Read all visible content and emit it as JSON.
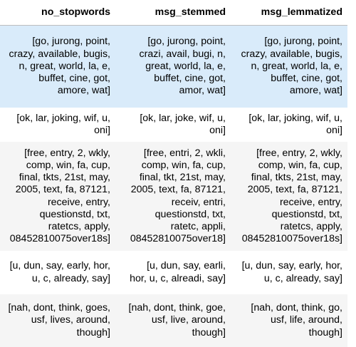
{
  "table": {
    "columns": [
      "no_stopwords",
      "msg_stemmed",
      "msg_lemmatized"
    ],
    "rows": [
      [
        "[go, jurong, point,\ncrazy, available, bugis,\nn, great, world, la, e,\nbuffet, cine, got,\namore, wat]",
        "[go, jurong, point,\ncrazi, avail, bugi, n,\ngreat, world, la, e,\nbuffet, cine, got,\namor, wat]",
        "[go, jurong, point,\ncrazy, available, bugis,\nn, great, world, la, e,\nbuffet, cine, got,\namore, wat]"
      ],
      [
        "[ok, lar, joking, wif, u,\noni]",
        "[ok, lar, joke, wif, u,\noni]",
        "[ok, lar, joking, wif, u,\noni]"
      ],
      [
        "[free, entry, 2, wkly,\ncomp, win, fa, cup,\nfinal, tkts, 21st, may,\n2005, text, fa, 87121,\nreceive, entry,\nquestionstd, txt,\nratetcs, apply,\n08452810075over18s]",
        "[free, entri, 2, wkli,\ncomp, win, fa, cup,\nfinal, tkt, 21st, may,\n2005, text, fa, 87121,\nreceiv, entri,\nquestionstd, txt,\nratetc, appli,\n08452810075over18]",
        "[free, entry, 2, wkly,\ncomp, win, fa, cup,\nfinal, tkts, 21st, may,\n2005, text, fa, 87121,\nreceive, entry,\nquestionstd, txt,\nratetcs, apply,\n08452810075over18s]"
      ],
      [
        "[u, dun, say, early, hor,\nu, c, already, say]",
        "[u, dun, say, earli,\nhor, u, c, alreadi, say]",
        "[u, dun, say, early, hor,\nu, c, already, say]"
      ],
      [
        "[nah, dont, think, goes,\nusf, lives, around,\nthough]",
        "[nah, dont, think, goe,\nusf, live, around,\nthough]",
        "[nah, dont, think, go,\nusf, life, around,\nthough]"
      ]
    ]
  }
}
